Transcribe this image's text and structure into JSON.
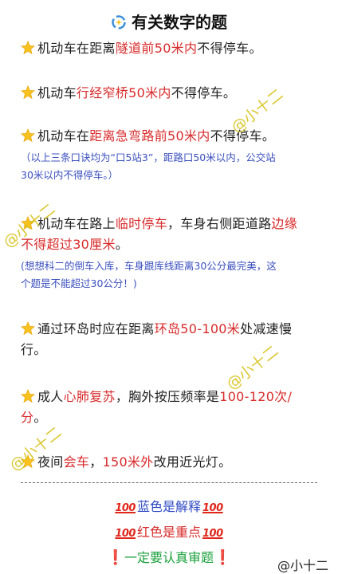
{
  "title": "有关数字的题",
  "items": [
    {
      "parts": [
        "机动车在距离",
        "隧道前50米内",
        "不得停车。"
      ]
    },
    {
      "parts": [
        "机动车",
        "行经窄桥50米内",
        "不得停车。"
      ]
    },
    {
      "parts": [
        "机动车在",
        "距离急弯路前50米内",
        "不得停车。"
      ]
    },
    {
      "parts": [
        "机动车在路上",
        "临时停车",
        "，车身右侧距道路",
        "边缘",
        "不得超过30厘米",
        "。"
      ]
    },
    {
      "parts": [
        "通过环岛时应在距离",
        "环岛50-100米",
        "处减速慢",
        "行。"
      ]
    },
    {
      "parts": [
        "成人",
        "心肺复苏",
        "，胸外按压频率是",
        "100-120次/",
        "分",
        "。"
      ]
    },
    {
      "parts": [
        "夜间",
        "会车",
        "，",
        "150米外",
        "改用近光灯。"
      ]
    }
  ],
  "notes": [
    "（以上三条口诀均为“口5站3”，距路口50米以内，公交站",
    "30米以内不得停车。）",
    "(想想科二的倒车入库，车身跟库线距离30公分最完美，这",
    "个题是不能超过30公分！)"
  ],
  "legend": {
    "hundred": "100",
    "blue_text": "蓝色是解释",
    "red_text": "红色是重点",
    "green_text": "一定要认真审题",
    "bang": "❗"
  },
  "watermark": "@小十二",
  "credit": "@小十二",
  "colors": {
    "red": "#d82a2a",
    "blue": "#3a4fbf",
    "green": "#1aa13c",
    "watermark": "#d8c21a"
  },
  "icons": {
    "title": "sparkle-ring-icon",
    "bullet": "star-icon"
  }
}
